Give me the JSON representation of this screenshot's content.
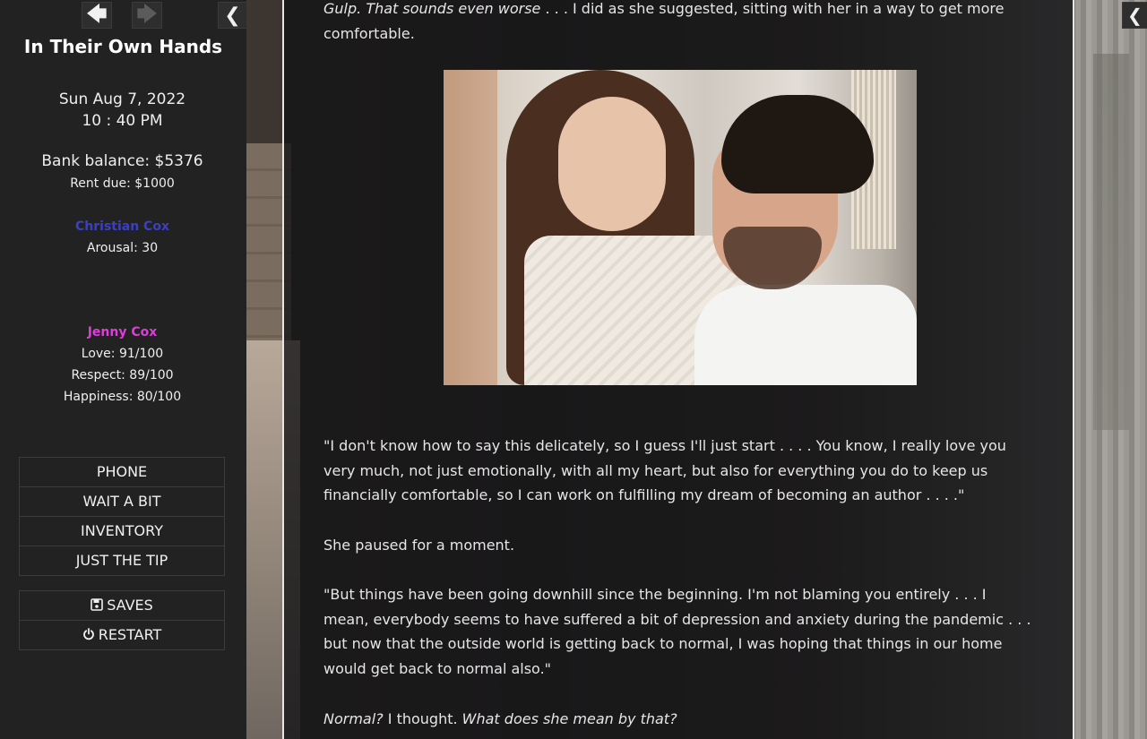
{
  "sidebar": {
    "history_back_icon": "arrow-left-icon",
    "history_forward_icon": "arrow-right-icon",
    "toggle_icon": "chevron-left-icon",
    "story_title": "In Their Own Hands",
    "date": "Sun Aug 7, 2022",
    "time": "10 : 40 PM",
    "bank_balance": "Bank balance: $5376",
    "rent_due": "Rent due: $1000",
    "characters": [
      {
        "name": "Christian Cox",
        "name_color": "#3b3fc4",
        "stats": [
          "Arousal: 30"
        ]
      },
      {
        "name": "Jenny Cox",
        "name_color": "#e03cdb",
        "stats": [
          "Love: 91/100",
          "Respect: 89/100",
          "Happiness: 80/100"
        ]
      }
    ],
    "menu": [
      "PHONE",
      "WAIT A BIT",
      "INVENTORY",
      "JUST THE TIP"
    ],
    "system_menu": [
      {
        "label": "SAVES",
        "icon": "floppy-disk-icon"
      },
      {
        "label": "RESTART",
        "icon": "power-icon"
      }
    ]
  },
  "right_toggle_icon": "chevron-left-icon",
  "passage": {
    "p1_italic": "Gulp. That sounds even worse",
    "p1_rest": " . . . I did as she suggested, sitting with her in a way to get more comfortable.",
    "p2": "\"I don't know how to say this delicately, so I guess I'll just start . . . . You know, I really love you very much, not just emotionally, with all my heart, but also for everything you do to keep us financially comfortable, so I can work on fulfilling my dream of becoming an author . . . .\"",
    "p3": "She paused for a moment.",
    "p4": "\"But things have been going downhill since the beginning. I'm not blaming you entirely . . . I mean, everybody seems to have suffered a bit of depression and anxiety during the pandemic . . . but now that the outside world is getting back to normal, I was hoping that things in our home would get back to normal also.\"",
    "p5_italic_a": "Normal?",
    "p5_plain": " I thought. ",
    "p5_italic_b": "What does she mean by that?"
  }
}
